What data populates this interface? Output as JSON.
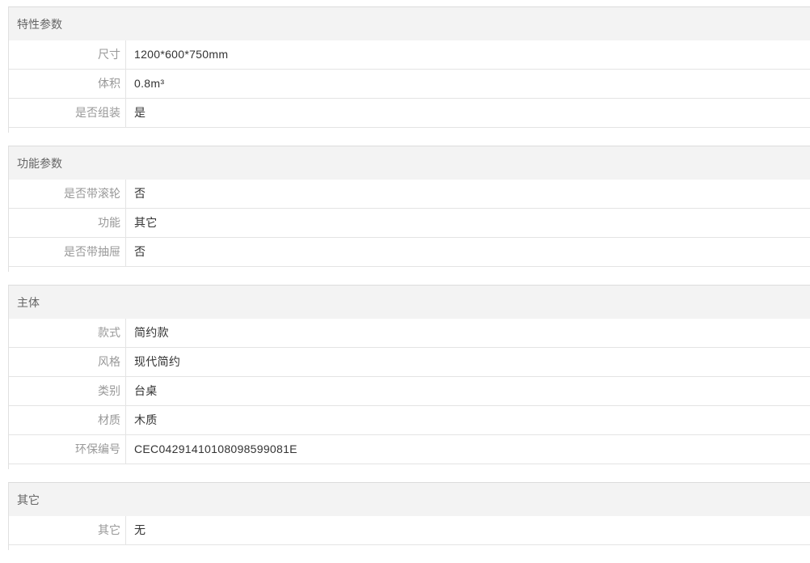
{
  "groups": [
    {
      "title": "特性参数",
      "rows": [
        {
          "label": "尺寸",
          "value": "1200*600*750mm"
        },
        {
          "label": "体积",
          "value": "0.8m³"
        },
        {
          "label": "是否组装",
          "value": "是"
        }
      ]
    },
    {
      "title": "功能参数",
      "rows": [
        {
          "label": "是否带滚轮",
          "value": "否"
        },
        {
          "label": "功能",
          "value": "其它"
        },
        {
          "label": "是否带抽屉",
          "value": "否"
        }
      ]
    },
    {
      "title": "主体",
      "rows": [
        {
          "label": "款式",
          "value": "简约款"
        },
        {
          "label": "风格",
          "value": "现代简约"
        },
        {
          "label": "类别",
          "value": "台桌"
        },
        {
          "label": "材质",
          "value": "木质"
        },
        {
          "label": "环保编号",
          "value": "CEC04291410108098599081E"
        }
      ]
    },
    {
      "title": "其它",
      "rows": [
        {
          "label": "其它",
          "value": "无"
        }
      ]
    }
  ]
}
